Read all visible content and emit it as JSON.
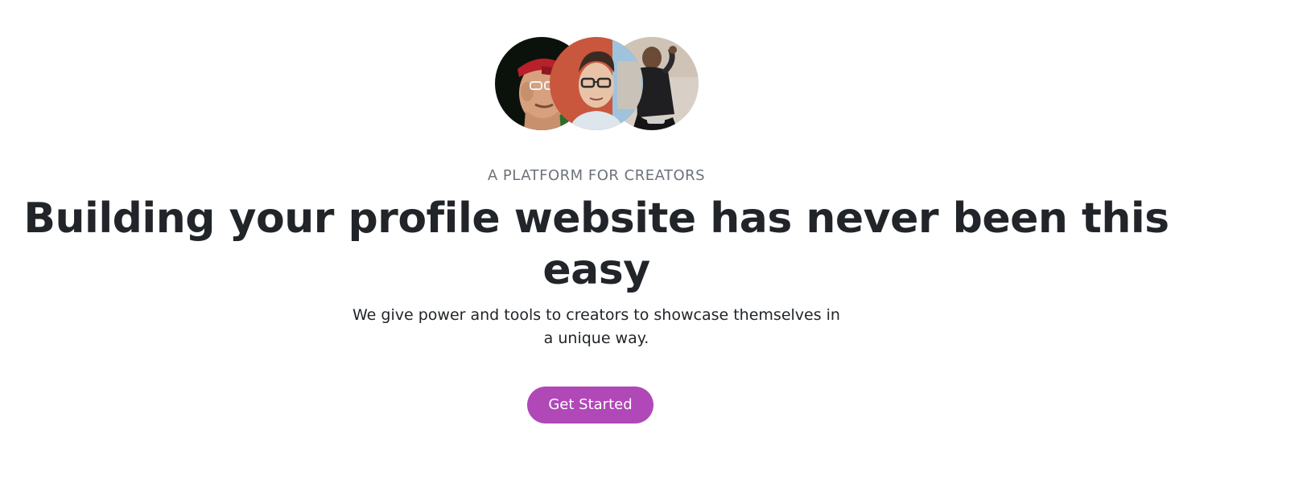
{
  "hero": {
    "avatars": [
      {
        "label": "creator-avatar-1"
      },
      {
        "label": "creator-avatar-2"
      },
      {
        "label": "creator-avatar-3"
      }
    ],
    "eyebrow": "A PLATFORM FOR CREATORS",
    "headline": "Building your profile website has never been this easy",
    "subtext": "We give power and tools to creators to showcase themselves in a unique way.",
    "cta_label": "Get Started"
  },
  "colors": {
    "accent": "#b048b8",
    "heading": "#212529",
    "muted": "#6c727a",
    "background": "#ffffff"
  }
}
